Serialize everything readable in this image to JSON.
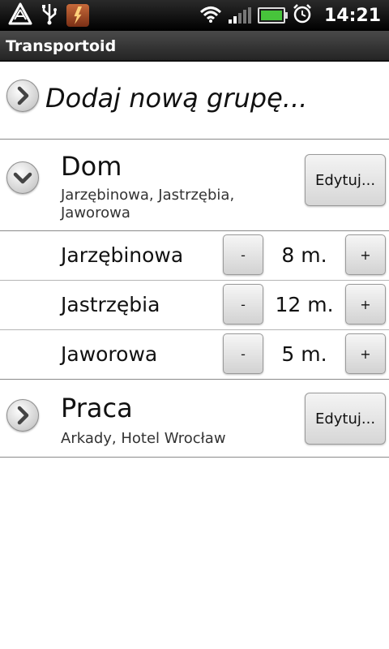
{
  "status_bar": {
    "time": "14:21",
    "icons": [
      "warning-icon",
      "usb-icon",
      "power-app-icon",
      "wifi-icon",
      "signal-icon",
      "battery-icon",
      "alarm-icon"
    ]
  },
  "app": {
    "title": "Transportoid"
  },
  "add_group": {
    "label": "Dodaj nową grupę...",
    "icon": "chevron-right-icon"
  },
  "groups": [
    {
      "name": "Dom",
      "subtitle": "Jarzębinowa, Jastrzębia, Jaworowa",
      "edit_label": "Edytuj...",
      "expanded": true,
      "icon": "chevron-down-icon",
      "stops": [
        {
          "name": "Jarzębinowa",
          "time": "8 m.",
          "minus_label": "-",
          "plus_label": "+"
        },
        {
          "name": "Jastrzębia",
          "time": "12 m.",
          "minus_label": "-",
          "plus_label": "+"
        },
        {
          "name": "Jaworowa",
          "time": "5 m.",
          "minus_label": "-",
          "plus_label": "+"
        }
      ]
    },
    {
      "name": "Praca",
      "subtitle": "Arkady, Hotel Wrocław",
      "edit_label": "Edytuj...",
      "expanded": false,
      "icon": "chevron-right-icon"
    }
  ],
  "colors": {
    "status_bar_bg": "#000000",
    "title_bar_bg": "#333333",
    "background": "#ffffff",
    "battery_fill": "#47c43b"
  }
}
